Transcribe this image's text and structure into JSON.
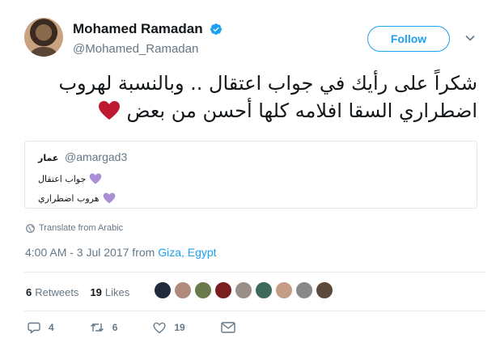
{
  "author": {
    "name": "Mohamed Ramadan",
    "handle": "@Mohamed_Ramadan",
    "verified": true
  },
  "follow_label": "Follow",
  "tweet": {
    "text": "شكراً على رأيك في جواب اعتقال .. وبالنسبة لهروب اضطراري السقا افلامه كلها أحسن من بعض",
    "emoji": "red-heart-icon"
  },
  "quoted": {
    "name": "عمار",
    "handle": "@amargad3",
    "lines": [
      "جواب اعتقال",
      "هروب اضطراري"
    ],
    "emoji": "purple-heart-icon"
  },
  "translate_label": "Translate from Arabic",
  "meta": {
    "time": "4:00 AM - 3 Jul 2017 from ",
    "location": "Giza, Egypt"
  },
  "stats": {
    "retweets_count": "6",
    "retweets_label": "Retweets",
    "likes_count": "19",
    "likes_label": "Likes"
  },
  "actions": {
    "replies": "4",
    "retweets": "6",
    "likes": "19"
  },
  "colors": {
    "accent": "#1da1f2",
    "muted": "#657786",
    "heart_red": "#be1931",
    "heart_purple": "#aa8ed6"
  }
}
